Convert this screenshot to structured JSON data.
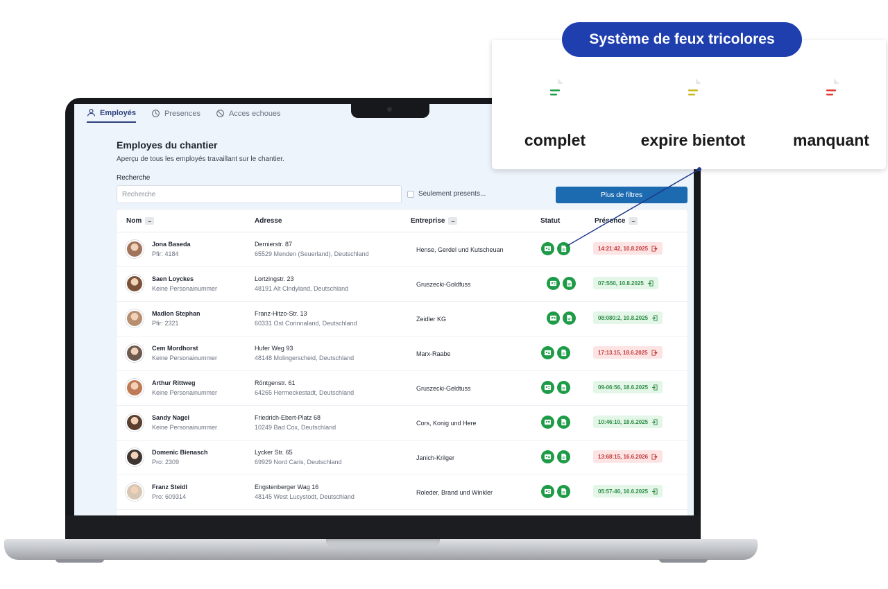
{
  "tabs": [
    {
      "label": "Employés",
      "icon": "people-icon",
      "active": true
    },
    {
      "label": "Presences",
      "icon": "clock-icon",
      "active": false
    },
    {
      "label": "Acces echoues",
      "icon": "ban-icon",
      "active": false
    }
  ],
  "page": {
    "title": "Employes du chantier",
    "subtitle": "Aperçu de tous les employés travaillant sur le chantier."
  },
  "search": {
    "label": "Recherche",
    "placeholder": "Recherche",
    "value": ""
  },
  "filters": {
    "present_only_label": "Seulement presents...",
    "more_filters_label": "Plus de filtres"
  },
  "table": {
    "headers": {
      "name": "Nom",
      "address": "Adresse",
      "company": "Entreprise",
      "status": "Statut",
      "presence": "Présence"
    },
    "sort_symbol": "–",
    "rows": [
      {
        "name": "Jona Baseda",
        "sub": "Pfir: 4184",
        "addr1": "Dernierstr. 87",
        "addr2": "65529 Menden (Seuerland), Deutschland",
        "company": "Hense, Gerdel und Kutscheuan",
        "presence": "14:21:42, 10.8.2025",
        "presence_state": "out",
        "avatar_color": "#a0745a"
      },
      {
        "name": "Saen Loyckes",
        "sub": "Keine Personainummer",
        "addr1": "Lortzingstr. 23",
        "addr2": "48191 Alt Clndyland, Deutschland",
        "company": "Gruszecki-Goldfuss",
        "presence": "07:S50, 10.8.2025",
        "presence_state": "in",
        "avatar_color": "#7a5238"
      },
      {
        "name": "Madlon Stephan",
        "sub": "Pfir: 2321",
        "addr1": "Franz-Hitzo-Str. 13",
        "addr2": "60331 Ost Corinnaland, Deutschland",
        "company": "Zeidler KG",
        "presence": "08:080:2, 10.8.2025",
        "presence_state": "in",
        "avatar_color": "#b88e70"
      },
      {
        "name": "Cem Mordhorst",
        "sub": "Keine Personainummer",
        "addr1": "Hufer Weg 93",
        "addr2": "48148 Molingerscheid, Deutschland",
        "company": "Marx-Raabe",
        "presence": "17:13.15, 18.6.2025",
        "presence_state": "out",
        "avatar_color": "#6d5a4f"
      },
      {
        "name": "Arthur Rittweg",
        "sub": "Keine Personainummer",
        "addr1": "Röntgenstr. 61",
        "addr2": "64265 Hermeckestadt, Deutschland",
        "company": "Gruszecki-Geldtuss",
        "presence": "09-06:56, 18.6.2025",
        "presence_state": "in",
        "avatar_color": "#c07a55"
      },
      {
        "name": "Sandy Nagel",
        "sub": "Keine Personainummer",
        "addr1": "Friedrich-Ebert-Platz 68",
        "addr2": "10249 Bad Cox, Deutschland",
        "company": "Cors, Konig und Here",
        "presence": "10:46:10, 18.6.2025",
        "presence_state": "in",
        "avatar_color": "#5a3e2e"
      },
      {
        "name": "Domenic Bienasch",
        "sub": "Pro: 2309",
        "addr1": "Lycker Str. 65",
        "addr2": "69929 Nord Caris, Deutschland",
        "company": "Janich-Krilger",
        "presence": "13:68:15, 16.6.2026",
        "presence_state": "out",
        "avatar_color": "#3e3430"
      },
      {
        "name": "Franz Steidl",
        "sub": "Pro: 609314",
        "addr1": "Engstenberger Wag 16",
        "addr2": "48145 West Lucystodt, Deutschland",
        "company": "Roleder, Brand und Winkler",
        "presence": "05:57-46, 16.6.2025",
        "presence_state": "in",
        "avatar_color": "#d8c6b4"
      }
    ]
  },
  "callout": {
    "title": "Système de feux tricolores",
    "items": [
      {
        "label": "complet",
        "color": "#1f9d4a",
        "icon": "document-icon"
      },
      {
        "label": "expire bientot",
        "color": "#c9b81c",
        "icon": "document-icon"
      },
      {
        "label": "manquant",
        "color": "#e03a3a",
        "icon": "document-icon"
      }
    ]
  },
  "colors": {
    "status_green": "#1e9b47",
    "primary_button": "#1c6ab0",
    "callout_pill": "#1f3faf",
    "presence_out_bg": "#fde4e4",
    "presence_in_bg": "#e3f6e7"
  }
}
